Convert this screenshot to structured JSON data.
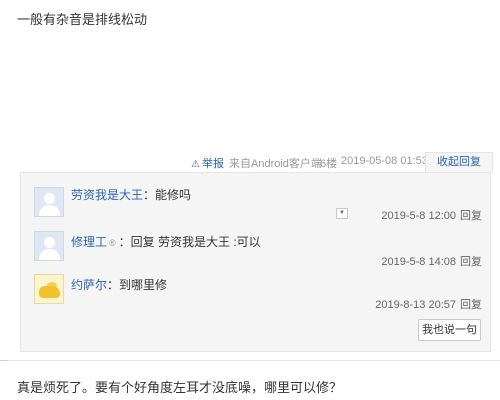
{
  "post": {
    "text": "一般有杂音是排线松动"
  },
  "meta": {
    "report_icon": "warning-triangle-icon",
    "report_label": "举报",
    "source": "来自Android客户端",
    "floor": "6楼",
    "time": "2019-05-08 01:53",
    "collapse_label": "收起回复"
  },
  "replies": [
    {
      "avatar": "default-user-avatar",
      "username": "劳资我是大王",
      "badge": "",
      "text": "：能修吗",
      "time": "2019-5-8 12:00",
      "reply_label": "回复"
    },
    {
      "avatar": "default-user-avatar",
      "username": "修理工",
      "badge": "®",
      "text": "：回复 劳资我是大王 :可以",
      "time": "2019-5-8 14:08",
      "reply_label": "回复"
    },
    {
      "avatar": "yellow-cartoon-avatar",
      "username": "约萨尔",
      "badge": "",
      "text": "：到哪里修",
      "time": "2019-8-13 20:57",
      "reply_label": "回复"
    }
  ],
  "say_button": "我也说一句",
  "next_post": {
    "text": "真是烦死了。要有个好角度左耳才没底噪，哪里可以修？"
  }
}
